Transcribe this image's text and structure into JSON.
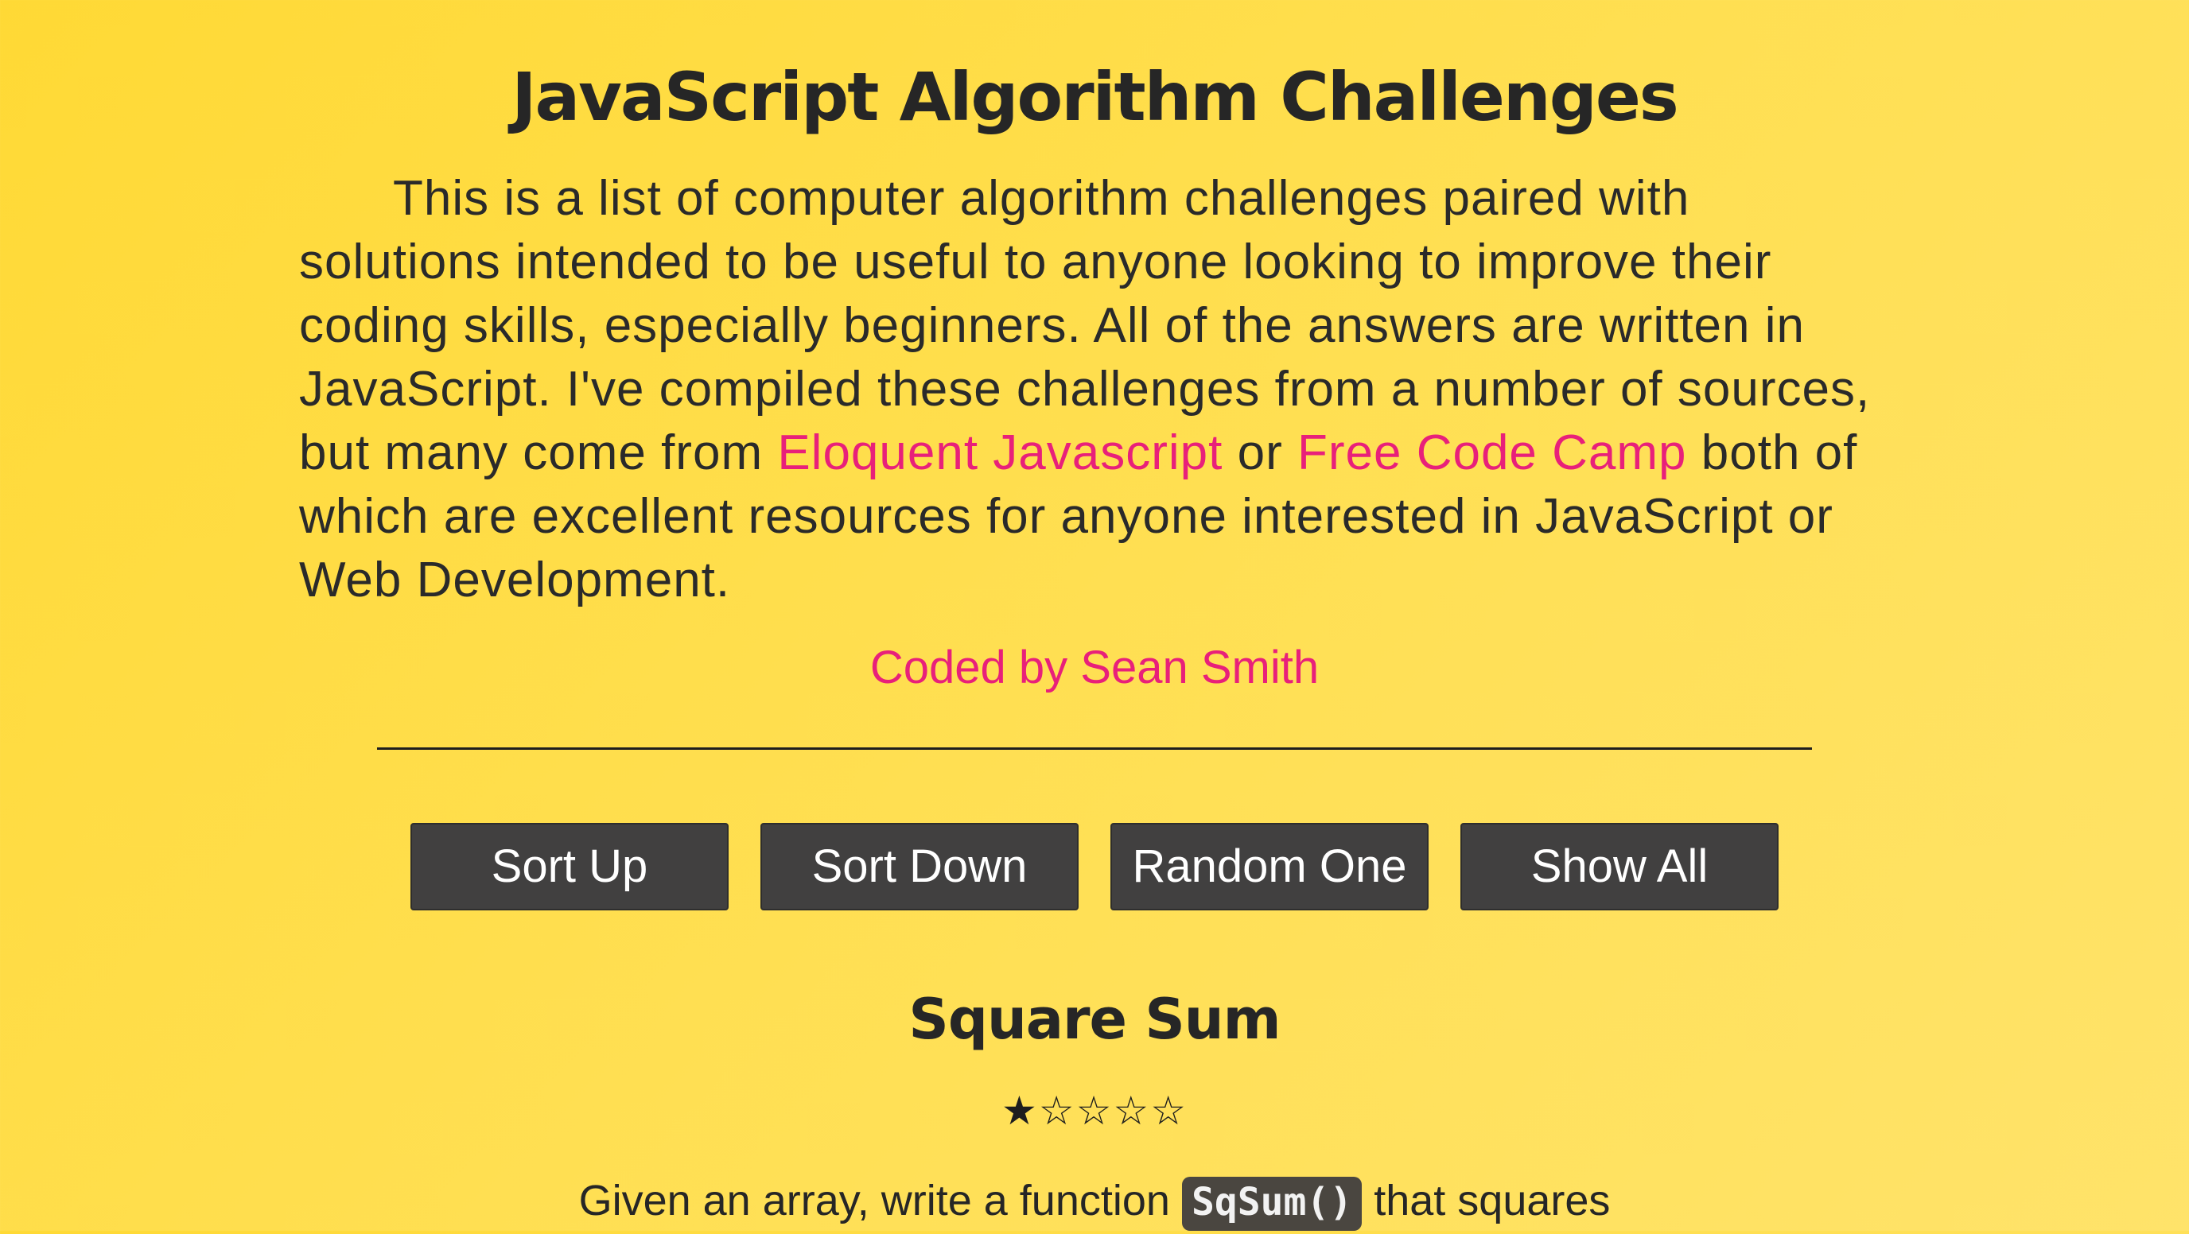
{
  "header": {
    "title": "JavaScript Algorithm Challenges"
  },
  "intro": {
    "text_1": "This is a list of computer algorithm challenges paired with solutions intended to be useful to anyone looking to improve their coding skills, especially beginners. All of the answers are written in JavaScript. I've compiled these challenges from a number of sources, but many come from ",
    "link_1": "Eloquent Javascript",
    "text_2": " or ",
    "link_2": "Free Code Camp",
    "text_3": " both of which are excellent resources for anyone interested in JavaScript or Web Development."
  },
  "credit": {
    "label": "Coded by Sean Smith"
  },
  "controls": {
    "sort_up": "Sort Up",
    "sort_down": "Sort Down",
    "random_one": "Random One",
    "show_all": "Show All"
  },
  "challenge": {
    "title": "Square Sum",
    "difficulty": {
      "rating": 1,
      "max": 5,
      "display": "★☆☆☆☆"
    },
    "description_before": "Given an array, write a function ",
    "code": "SqSum()",
    "description_after": " that squares"
  },
  "colors": {
    "background": "#ffdb3f",
    "link": "#e8207a",
    "button": "#414040",
    "text": "#262626"
  }
}
